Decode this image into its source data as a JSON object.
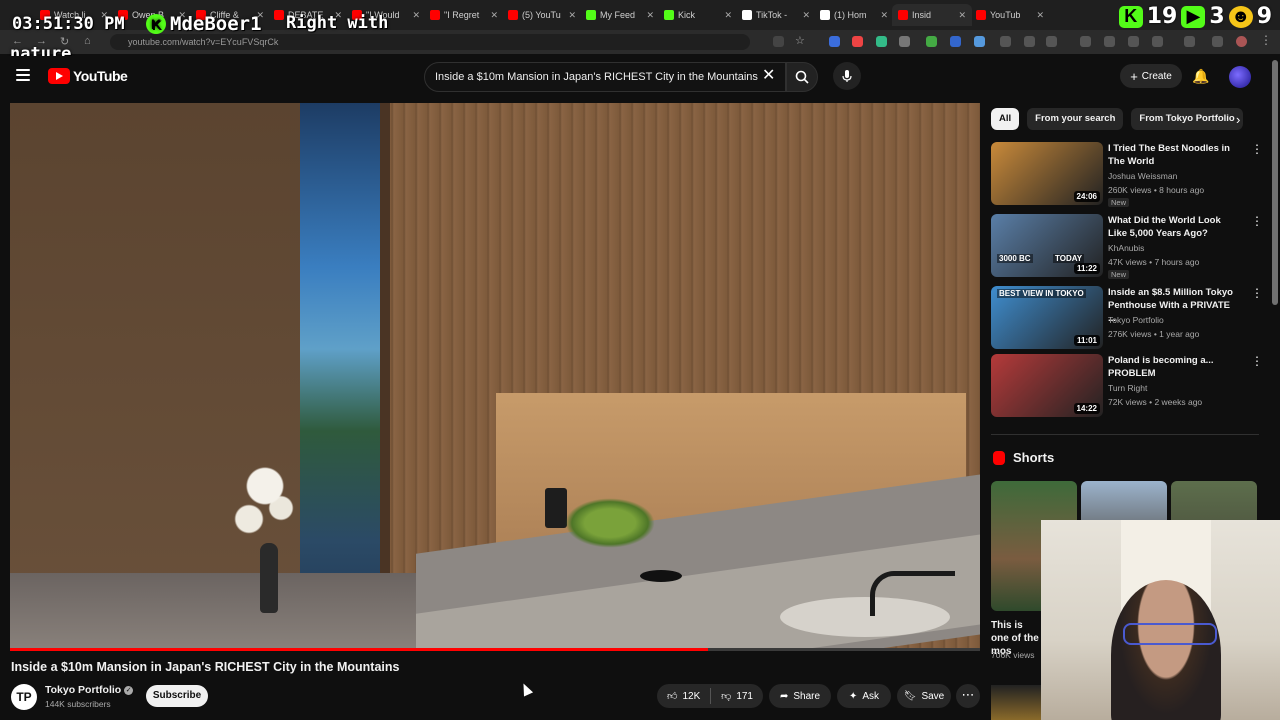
{
  "stream_overlay": {
    "clock": "03:51:30 PM",
    "username": "MdeBoer1",
    "message_part1": "Right with",
    "message_part2": "nature",
    "counter_a": "19",
    "counter_b": "3",
    "counter_c": "9"
  },
  "browser": {
    "url": "youtube.com/watch?v=EYcuFVSqrCk",
    "tabs": [
      {
        "label": "Watch li",
        "color": "#ff0000"
      },
      {
        "label": "Owen B",
        "color": "#ff0000"
      },
      {
        "label": "Cliffe &",
        "color": "#ff0000"
      },
      {
        "label": "DEBATE",
        "color": "#ff0000"
      },
      {
        "label": "\"I Would",
        "color": "#ff0000"
      },
      {
        "label": "\"I Regret",
        "color": "#ff0000"
      },
      {
        "label": "(5) YouTu",
        "color": "#ff0000"
      },
      {
        "label": "My Feed",
        "color": "#53fc18"
      },
      {
        "label": "Kick",
        "color": "#53fc18"
      },
      {
        "label": "TikTok -",
        "color": "#ffffff"
      },
      {
        "label": "(1) Hom",
        "color": "#ffffff"
      },
      {
        "label": "Insid",
        "color": "#ff0000"
      },
      {
        "label": "YouTub",
        "color": "#ff0000"
      }
    ]
  },
  "youtube": {
    "logo_text": "YouTube",
    "search_value": "Inside a $10m Mansion in Japan's RICHEST City in the Mountains",
    "create_label": "Create"
  },
  "video": {
    "title": "Inside a $10m Mansion in Japan's RICHEST City in the Mountains",
    "channel_initial": "TP",
    "channel_name": "Tokyo Portfolio",
    "subscribers": "144K subscribers",
    "subscribe_label": "Subscribe",
    "likes": "12K",
    "dislikes": "171",
    "share_label": "Share",
    "ask_label": "Ask",
    "save_label": "Save",
    "progress": 0.72
  },
  "sidebar": {
    "chips": [
      "All",
      "From your search",
      "From Tokyo Portfolio"
    ],
    "recommendations": [
      {
        "title": "I Tried The Best Noodles in The World",
        "channel": "Joshua Weissman",
        "meta": "260K views • 8 hours ago",
        "badge": "New",
        "duration": "24:06",
        "thumb_color": "#c98a3a"
      },
      {
        "title": "What Did the World Look Like 5,000 Years Ago?",
        "channel": "KhAnubis",
        "meta": "47K views • 7 hours ago",
        "badge": "New",
        "duration": "11:22",
        "thumb_color": "#5a7fa8",
        "thumb_text_a": "3000 BC",
        "thumb_text_b": "TODAY"
      },
      {
        "title": "Inside an $8.5 Million Tokyo Penthouse With a PRIVATE ...",
        "channel": "Tokyo Portfolio",
        "meta": "276K views • 1 year ago",
        "badge": "",
        "duration": "11:01",
        "thumb_color": "#3f8ed0",
        "thumb_text_a": "BEST VIEW IN TOKYO"
      },
      {
        "title": "Poland is becoming a... PROBLEM",
        "channel": "Turn Right",
        "meta": "72K views • 2 weeks ago",
        "badge": "",
        "duration": "14:22",
        "thumb_color": "#b53a3a"
      }
    ],
    "shorts_title": "Shorts",
    "short_caption": "This is one of the mos",
    "short_views": "706K views"
  }
}
